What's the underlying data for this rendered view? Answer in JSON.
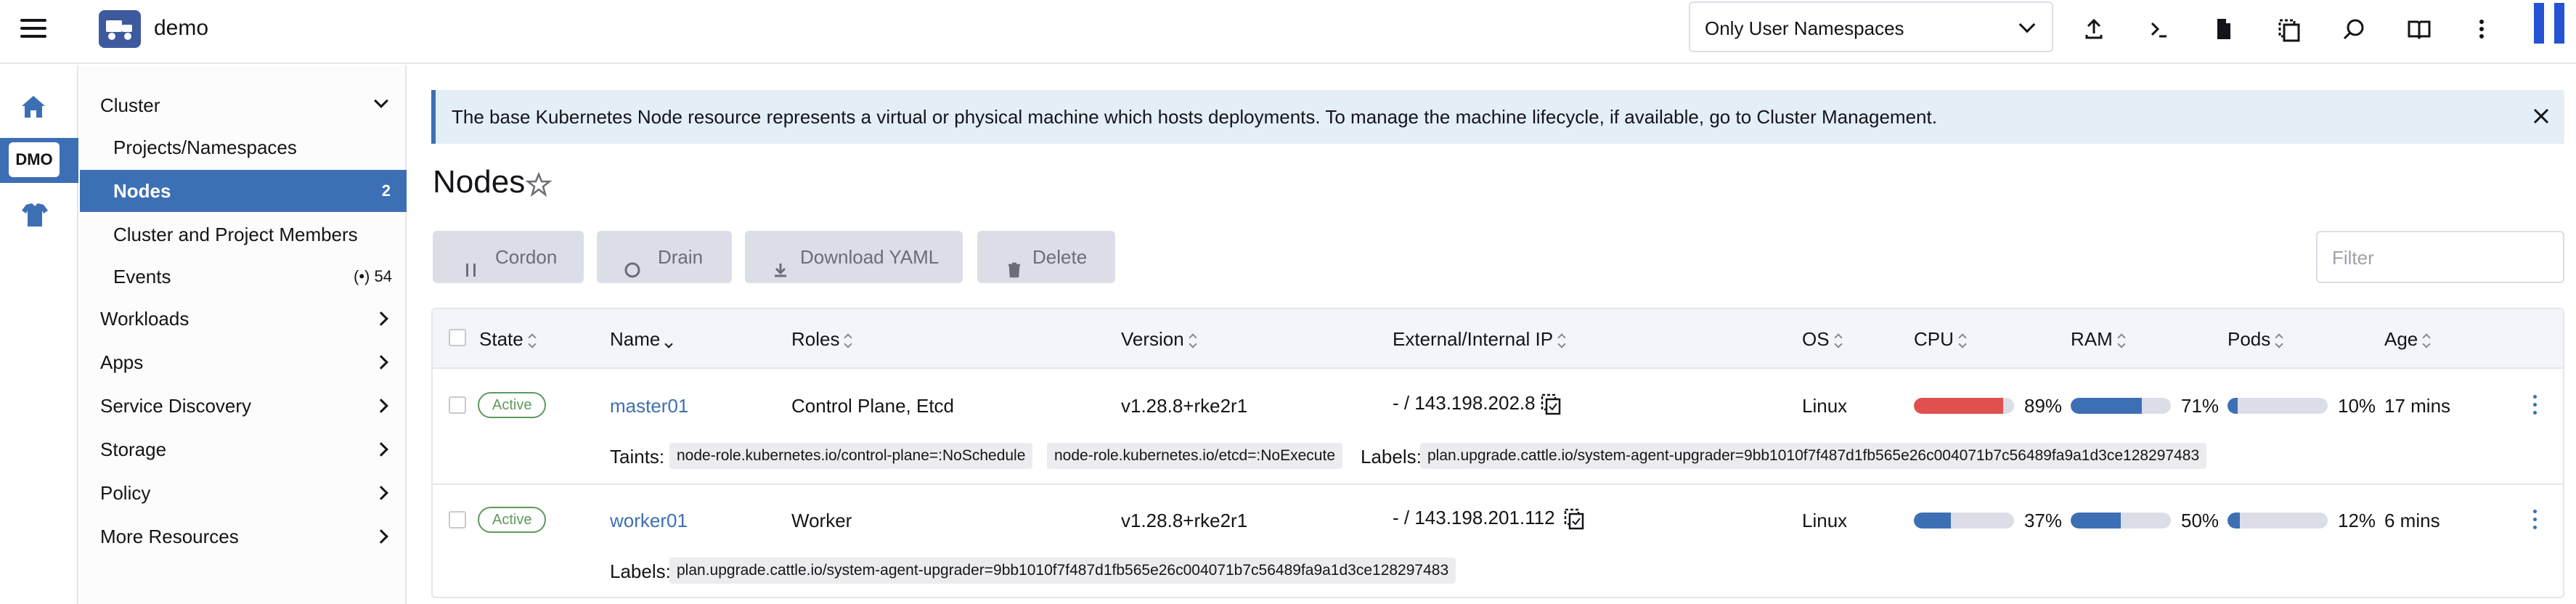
{
  "header": {
    "cluster_name": "demo",
    "namespace_filter": "Only User Namespaces",
    "icons": [
      "import-yaml-icon",
      "kubectl-shell-icon",
      "kubeconfig-download-icon",
      "copy-kubeconfig-icon",
      "resource-search-icon",
      "docs-icon",
      "more-actions-icon"
    ]
  },
  "rail": {
    "home_icon": "home-icon",
    "cluster_badge": "DMO",
    "extensions_icon": "shirt-icon"
  },
  "nav": {
    "group_cluster": "Cluster",
    "items": [
      {
        "label": "Projects/Namespaces"
      },
      {
        "label": "Nodes",
        "count": "2"
      },
      {
        "label": "Cluster and Project Members"
      },
      {
        "label": "Events",
        "count": "54"
      }
    ],
    "groups": [
      "Workloads",
      "Apps",
      "Service Discovery",
      "Storage",
      "Policy",
      "More Resources"
    ]
  },
  "banner": {
    "message": "The base Kubernetes Node resource represents a virtual or physical machine which hosts deployments. To manage the machine lifecycle, if available, go to Cluster Management."
  },
  "page": {
    "title": "Nodes"
  },
  "actions": {
    "cordon": "Cordon",
    "drain": "Drain",
    "download_yaml": "Download YAML",
    "delete": "Delete",
    "filter_placeholder": "Filter"
  },
  "table": {
    "columns": [
      "State",
      "Name",
      "Roles",
      "Version",
      "External/Internal IP",
      "OS",
      "CPU",
      "RAM",
      "Pods",
      "Age"
    ],
    "rows": [
      {
        "state": "Active",
        "name": "master01",
        "roles": "Control Plane, Etcd",
        "version": "v1.28.8+rke2r1",
        "ip": "- / 143.198.202.8",
        "os": "Linux",
        "cpu": "89%",
        "cpu_fraction": 0.89,
        "ram": "71%",
        "ram_fraction": 0.71,
        "pods": "10%",
        "pods_fraction": 0.1,
        "age": "17 mins",
        "taints_label": "Taints:",
        "taints": [
          "node-role.kubernetes.io/control-plane=:NoSchedule",
          "node-role.kubernetes.io/etcd=:NoExecute"
        ],
        "labels_label": "Labels:",
        "labels": [
          "plan.upgrade.cattle.io/system-agent-upgrader=9bb1010f7f487d1fb565e26c004071b7c56489fa9a1d3ce128297483"
        ]
      },
      {
        "state": "Active",
        "name": "worker01",
        "roles": "Worker",
        "version": "v1.28.8+rke2r1",
        "ip": "- / 143.198.201.112",
        "os": "Linux",
        "cpu": "37%",
        "cpu_fraction": 0.37,
        "ram": "50%",
        "ram_fraction": 0.5,
        "pods": "12%",
        "pods_fraction": 0.12,
        "age": "6 mins",
        "labels_label": "Labels:",
        "labels": [
          "plan.upgrade.cattle.io/system-agent-upgrader=9bb1010f7f487d1fb565e26c004071b7c56489fa9a1d3ce128297483"
        ]
      }
    ]
  },
  "colors": {
    "accent": "#3d6fb5",
    "cpu_high": "#e0504f",
    "usage": "#3d6fb5",
    "active_state": "#5d995d",
    "banner_bg": "#e3eef7"
  }
}
